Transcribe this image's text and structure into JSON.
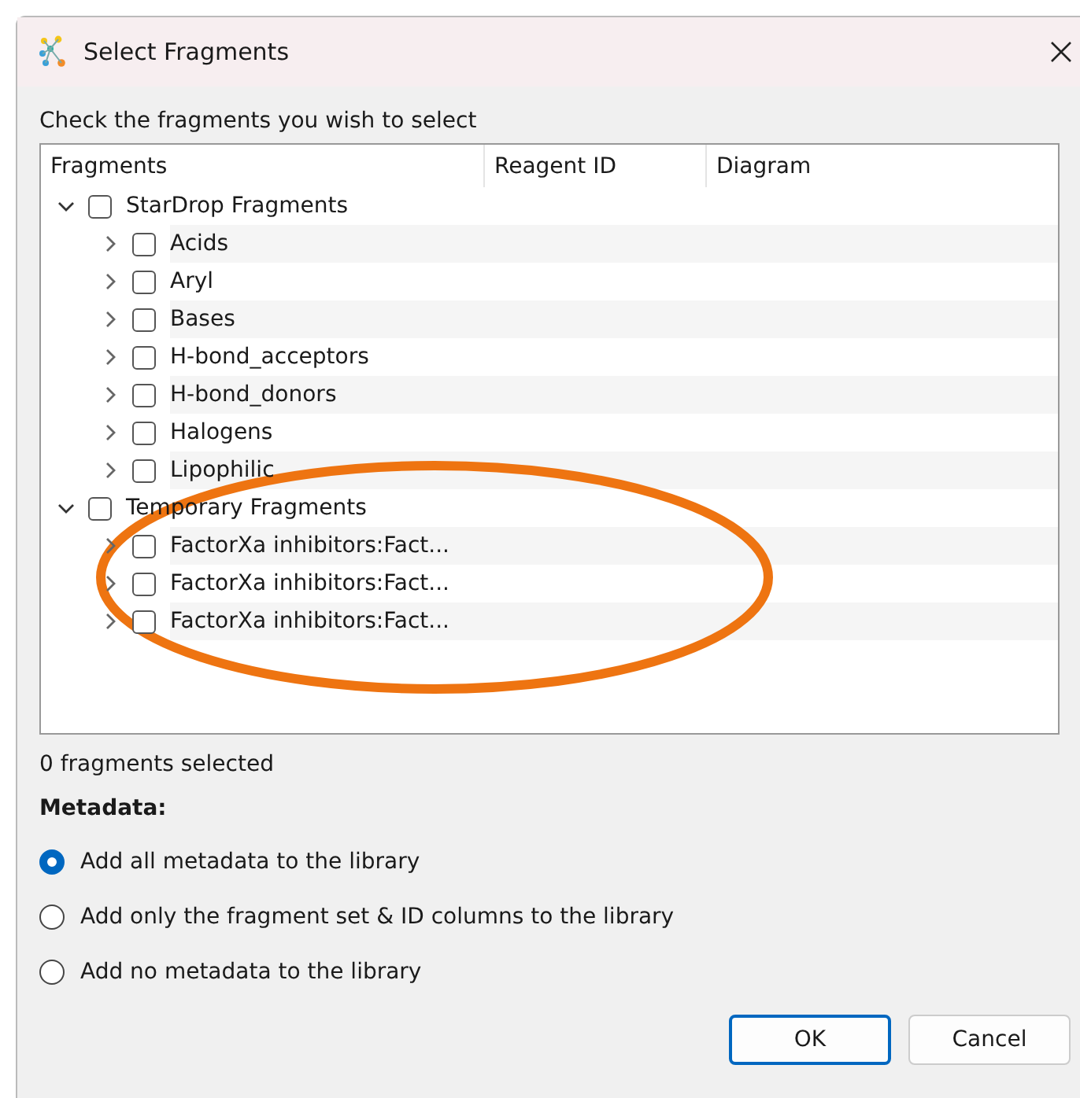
{
  "window": {
    "title": "Select Fragments"
  },
  "instruction": "Check the fragments you wish to select",
  "tree": {
    "columns": [
      "Fragments",
      "Reagent ID",
      "Diagram"
    ],
    "items": [
      {
        "label": "StarDrop Fragments",
        "expanded": true,
        "checked": false,
        "children": [
          {
            "label": "Acids",
            "expanded": false,
            "checked": false
          },
          {
            "label": "Aryl",
            "expanded": false,
            "checked": false
          },
          {
            "label": "Bases",
            "expanded": false,
            "checked": false
          },
          {
            "label": "H-bond_acceptors",
            "expanded": false,
            "checked": false
          },
          {
            "label": "H-bond_donors",
            "expanded": false,
            "checked": false
          },
          {
            "label": "Halogens",
            "expanded": false,
            "checked": false
          },
          {
            "label": "Lipophilic",
            "expanded": false,
            "checked": false
          }
        ]
      },
      {
        "label": "Temporary Fragments",
        "expanded": true,
        "checked": false,
        "children": [
          {
            "label": "FactorXa inhibitors:Fact...",
            "expanded": false,
            "checked": false
          },
          {
            "label": "FactorXa inhibitors:Fact...",
            "expanded": false,
            "checked": false
          },
          {
            "label": "FactorXa inhibitors:Fact...",
            "expanded": false,
            "checked": false
          }
        ]
      }
    ]
  },
  "selection_count": "0 fragments selected",
  "metadata": {
    "heading": "Metadata:",
    "options": [
      {
        "label": "Add all metadata to the library",
        "selected": true
      },
      {
        "label": "Add only the fragment set & ID columns to the library",
        "selected": false
      },
      {
        "label": "Add no metadata to the library",
        "selected": false
      }
    ]
  },
  "buttons": [
    "OK",
    "Cancel"
  ]
}
